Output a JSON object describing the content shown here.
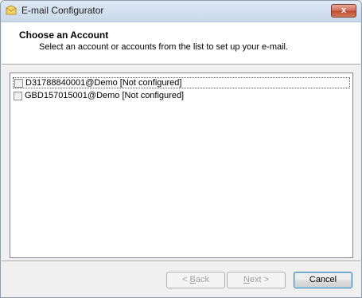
{
  "window": {
    "title": "E-mail Configurator",
    "close_label": "x"
  },
  "header": {
    "title": "Choose an Account",
    "subtitle": "Select an account or accounts from the list to set up your e-mail."
  },
  "accounts": [
    {
      "label": "D31788840001@Demo [Not configured]",
      "checked": false,
      "focused": true
    },
    {
      "label": "GBD157015001@Demo [Not configured]",
      "checked": false,
      "focused": false
    }
  ],
  "buttons": {
    "back": {
      "mnemonic": "B",
      "rest": "ack",
      "prefix": "< ",
      "enabled": false
    },
    "next": {
      "mnemonic": "N",
      "rest": "ext",
      "suffix": " >",
      "enabled": false
    },
    "cancel": {
      "label": "Cancel",
      "enabled": true
    }
  },
  "icons": {
    "app": "email-envelope-icon"
  }
}
